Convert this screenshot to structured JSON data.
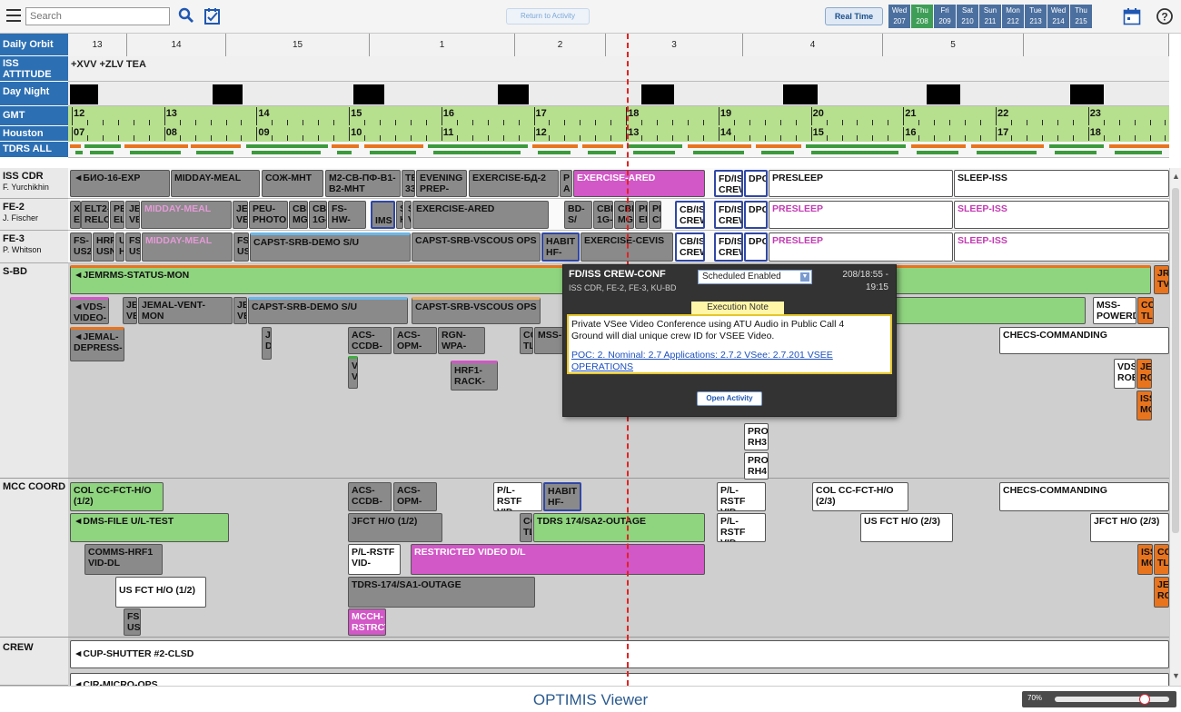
{
  "toolbar": {
    "search_placeholder": "Search",
    "return_label": "Return to Activity",
    "realtime_label": "Real Time",
    "days": [
      {
        "name": "Wed",
        "num": "207"
      },
      {
        "name": "Thu",
        "num": "208",
        "current": true
      },
      {
        "name": "Fri",
        "num": "209"
      },
      {
        "name": "Sat",
        "num": "210"
      },
      {
        "name": "Sun",
        "num": "211"
      },
      {
        "name": "Mon",
        "num": "212"
      },
      {
        "name": "Tue",
        "num": "213"
      },
      {
        "name": "Wed",
        "num": "214"
      },
      {
        "name": "Thu",
        "num": "215"
      }
    ]
  },
  "rows": {
    "daily_orbit": "Daily Orbit",
    "iss_attitude": "ISS ATTITUDE",
    "day_night": "Day Night",
    "gmt": "GMT",
    "houston": "Houston",
    "tdrs_all": "TDRS ALL",
    "iss_cdr": "ISS CDR",
    "iss_cdr_name": "F. Yurchikhin",
    "fe2": "FE-2",
    "fe2_name": "J. Fischer",
    "fe3": "FE-3",
    "fe3_name": "P. Whitson",
    "sbd": "S-BD",
    "mcc": "MCC COORD",
    "crew": "CREW"
  },
  "orbits": [
    "13",
    "14",
    "15",
    "1",
    "2",
    "3",
    "4",
    "5"
  ],
  "attitude": "+XVV +ZLV TEA",
  "gmt_hours": [
    "12",
    "13",
    "14",
    "15",
    "16",
    "17",
    "18",
    "19",
    "20",
    "21",
    "22",
    "23"
  ],
  "houston_hours": [
    "07",
    "08",
    "09",
    "10",
    "11",
    "12",
    "13",
    "14",
    "15",
    "16",
    "17",
    "18"
  ],
  "activities": {
    "cdr": [
      {
        "text": "◄БИО-16-EXP",
        "color": "gray"
      },
      {
        "text": "MIDDAY-MEAL",
        "color": "gray"
      },
      {
        "text": "СОЖ-МНТ",
        "color": "gray"
      },
      {
        "text": "М2-СВ-ПФ-В1-\nВ2-МНТ",
        "color": "gray"
      },
      {
        "text": "TE\n33",
        "color": "gray"
      },
      {
        "text": "EVENING\nPREP-",
        "color": "gray"
      },
      {
        "text": "EXERCISE-БД-2",
        "color": "gray"
      },
      {
        "text": "P\nA",
        "color": "gray"
      },
      {
        "text": "EXERCISE-ARED",
        "color": "magenta"
      },
      {
        "text": "FD/IS\nCREW",
        "color": "white"
      },
      {
        "text": "DPC",
        "color": "white"
      },
      {
        "text": "PRESLEEP",
        "color": "white"
      },
      {
        "text": "SLEEP-ISS",
        "color": "white"
      }
    ],
    "fe2": [
      {
        "text": "X\nE",
        "color": "gray"
      },
      {
        "text": "ELT2-\nRELO",
        "color": "gray"
      },
      {
        "text": "PE\nEL",
        "color": "gray"
      },
      {
        "text": "JEI\nVE",
        "color": "gray"
      },
      {
        "text": "MIDDAY-MEAL",
        "color": "gray"
      },
      {
        "text": "JEI\nVE",
        "color": "gray"
      },
      {
        "text": "PEU-\nPHOTO",
        "color": "gray"
      },
      {
        "text": "CBE\nMG-",
        "color": "gray"
      },
      {
        "text": "CBE\n1G-",
        "color": "gray"
      },
      {
        "text": "FS-\nHW-",
        "color": "gray"
      },
      {
        "text": "IMS",
        "color": "gray"
      },
      {
        "text": "S\nH",
        "color": "gray"
      },
      {
        "text": "S\nV",
        "color": "gray"
      },
      {
        "text": "EXERCISE-ARED",
        "color": "gray"
      },
      {
        "text": "BD-S/",
        "color": "gray"
      },
      {
        "text": "CBE\n1G-",
        "color": "gray"
      },
      {
        "text": "CBE\nMG-",
        "color": "gray"
      },
      {
        "text": "PE\nEL",
        "color": "gray"
      },
      {
        "text": "PE\nCL",
        "color": "gray"
      },
      {
        "text": "CB/IS\nCREW",
        "color": "white"
      },
      {
        "text": "FD/IS\nCREW",
        "color": "white"
      },
      {
        "text": "DPC",
        "color": "white"
      },
      {
        "text": "PRESLEEP",
        "color": "white"
      },
      {
        "text": "SLEEP-ISS",
        "color": "white"
      }
    ],
    "fe3": [
      {
        "text": "FS-\nUS2",
        "color": "gray"
      },
      {
        "text": "HRF\nUSN",
        "color": "gray"
      },
      {
        "text": "U\nH",
        "color": "gray"
      },
      {
        "text": "FS\nUS",
        "color": "gray"
      },
      {
        "text": "MIDDAY-MEAL",
        "color": "gray"
      },
      {
        "text": "FS\nUS",
        "color": "gray"
      },
      {
        "text": "CAPST-SRB-DEMO S/U",
        "color": "gray"
      },
      {
        "text": "CAPST-SRB-VSCOUS OPS",
        "color": "gray"
      },
      {
        "text": "HABIT\nHF-",
        "color": "gray"
      },
      {
        "text": "EXERCISE-CEVIS",
        "color": "gray"
      },
      {
        "text": "CB/IS\nCREW",
        "color": "white"
      },
      {
        "text": "FD/IS\nCREW",
        "color": "white"
      },
      {
        "text": "DPC",
        "color": "white"
      },
      {
        "text": "PRESLEEP",
        "color": "white"
      },
      {
        "text": "SLEEP-ISS",
        "color": "white"
      }
    ],
    "sbd": [
      {
        "text": "◄JEMRMS-STATUS-MON",
        "color": "green"
      },
      {
        "text": "◄VDS-\nVIDEO-",
        "color": "gray"
      },
      {
        "text": "JEI\nVE",
        "color": "gray"
      },
      {
        "text": "JEMAL-VENT-\nMON",
        "color": "gray"
      },
      {
        "text": "JEI\nVE",
        "color": "gray"
      },
      {
        "text": "CAPST-SRB-DEMO S/U",
        "color": "gray"
      },
      {
        "text": "CAPST-SRB-VSCOUS OPS",
        "color": "gray"
      },
      {
        "text": "◄JEMAL-\nDEPRESS-",
        "color": "gray"
      },
      {
        "text": "J\nD",
        "color": "gray"
      },
      {
        "text": "ACS-\nCCDB-",
        "color": "gray"
      },
      {
        "text": "V\nV",
        "color": "gray"
      },
      {
        "text": "ACS-\nOPM-",
        "color": "gray"
      },
      {
        "text": "RGN-\nWPA-",
        "color": "gray"
      },
      {
        "text": "HRF1-\nRACK-",
        "color": "gray"
      },
      {
        "text": "CC\nTL",
        "color": "gray"
      },
      {
        "text": "MSS-",
        "color": "gray"
      },
      {
        "text": "PRO\nRH3",
        "color": "white"
      },
      {
        "text": "PRO\nRH4",
        "color": "white"
      },
      {
        "text": "MSS-\nPOWERD",
        "color": "white"
      },
      {
        "text": "CC\nTL",
        "color": "orange"
      },
      {
        "text": "JRI\nTV",
        "color": "orange"
      },
      {
        "text": "CHECS-COMMANDING",
        "color": "white"
      },
      {
        "text": "VDS\nROB",
        "color": "white"
      },
      {
        "text": "JEI\nRC",
        "color": "orange"
      },
      {
        "text": "ISS\nMC",
        "color": "orange"
      }
    ],
    "mcc": [
      {
        "text": "COL CC-FCT-H/O\n(1/2)",
        "color": "green"
      },
      {
        "text": "ACS-\nCCDB-",
        "color": "gray"
      },
      {
        "text": "ACS-\nOPM-",
        "color": "gray"
      },
      {
        "text": "P/L-RSTF\nVID-",
        "color": "white"
      },
      {
        "text": "HABIT\nHF-",
        "color": "gray"
      },
      {
        "text": "P/L-RSTF\nVID-",
        "color": "white"
      },
      {
        "text": "COL CC-FCT-H/O\n(2/3)",
        "color": "white"
      },
      {
        "text": "CHECS-COMMANDING",
        "color": "white"
      },
      {
        "text": "◄DMS-FILE U/L-TEST",
        "color": "green"
      },
      {
        "text": "JFCT H/O (1/2)",
        "color": "gray"
      },
      {
        "text": "CC\nTL",
        "color": "gray"
      },
      {
        "text": "TDRS 174/SA2-OUTAGE",
        "color": "green"
      },
      {
        "text": "P/L-RSTF\nVID-",
        "color": "white"
      },
      {
        "text": "US FCT H/O (2/3)",
        "color": "white"
      },
      {
        "text": "JFCT H/O (2/3)",
        "color": "white"
      },
      {
        "text": "COMMS-HRF1\nVID-DL",
        "color": "gray"
      },
      {
        "text": "P/L-RSTF\nVID-",
        "color": "white"
      },
      {
        "text": "RESTRICTED VIDEO D/L",
        "color": "magenta"
      },
      {
        "text": "ISS\nMC",
        "color": "orange"
      },
      {
        "text": "CC\nTL",
        "color": "orange"
      },
      {
        "text": "US FCT H/O (1/2)",
        "color": "white"
      },
      {
        "text": "TDRS-174/SA1-OUTAGE",
        "color": "gray"
      },
      {
        "text": "JEI\nRC",
        "color": "orange"
      },
      {
        "text": "FS\nUS",
        "color": "gray"
      },
      {
        "text": "MCCH-\nRSTRCT",
        "color": "magenta"
      }
    ],
    "crew": [
      {
        "text": "◄CUP-SHUTTER #2-CLSD",
        "color": "white"
      },
      {
        "text": "◄CIR-MICRO-OPS",
        "color": "white"
      }
    ]
  },
  "popup": {
    "title": "FD/ISS CREW-CONF",
    "subtitle": "ISS CDR, FE-2, FE-3, KU-BD",
    "status": "Scheduled Enabled",
    "time_start": "208/18:55 -",
    "time_end": "19:15",
    "note_header": "Execution Note",
    "note_line1": "Private VSee Video Conference using ATU Audio in Public Call 4",
    "note_line2": "Ground will dial unique crew ID for VSEE Video.",
    "link": "POC: 2. Nominal: 2.7 Applications: 2.7.2 VSee: 2.7.201 VSEE OPERATIONS",
    "open_label": "Open Activity"
  },
  "footer": {
    "title": "OPTIMIS Viewer",
    "zoom_label": "70%",
    "zoom_level": 0.82
  },
  "colors": {
    "label_blue": "#2c6fb3",
    "gray": "#8a8a8a",
    "green": "#8fd47f",
    "magenta": "#d257c7",
    "orange": "#e8741e",
    "current_time": "#e32222"
  }
}
